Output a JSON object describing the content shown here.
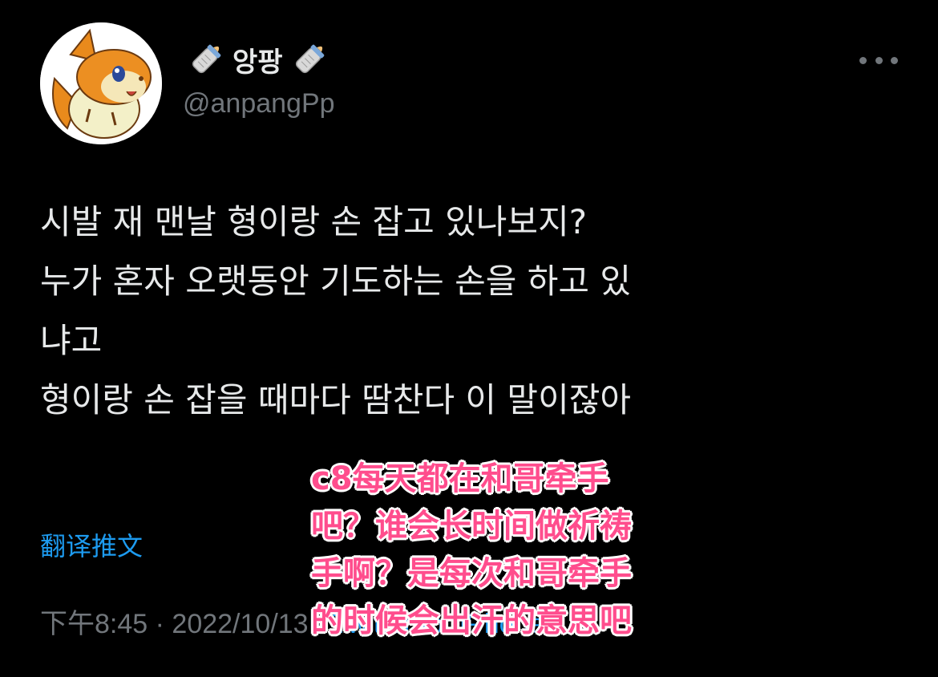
{
  "user": {
    "display_name": "앙팡",
    "handle": "@anpangPp",
    "avatar_icon": "orange-hamster-mascot-avatar",
    "name_decoration_icon": "baby-bottle-emoji"
  },
  "header": {
    "more_icon": "more-options-icon"
  },
  "tweet": {
    "lines": [
      "시발 재 맨날 형이랑 손 잡고 있나보지?",
      "누가 혼자 오랫동안 기도하는 손을 하고 있",
      "냐고",
      "형이랑 손 잡을 때마다 땀찬다 이 말이잖아"
    ]
  },
  "translate_label": "翻译推文",
  "meta": {
    "time": "下午8:45",
    "separator": "·",
    "date": "2022/10/13",
    "source": "Twitter for iPhone"
  },
  "overlay": {
    "lines": [
      "c8每天都在和哥牵手",
      "吧？谁会长时间做祈祷",
      "手啊？是每次和哥牵手",
      "的时候会出汗的意思吧"
    ]
  },
  "colors": {
    "background": "#000000",
    "text": "#e7e9ea",
    "secondary": "#71767b",
    "link": "#1d9bf0",
    "overlay_text": "#ff4d8d",
    "overlay_outline": "#ffffff"
  }
}
